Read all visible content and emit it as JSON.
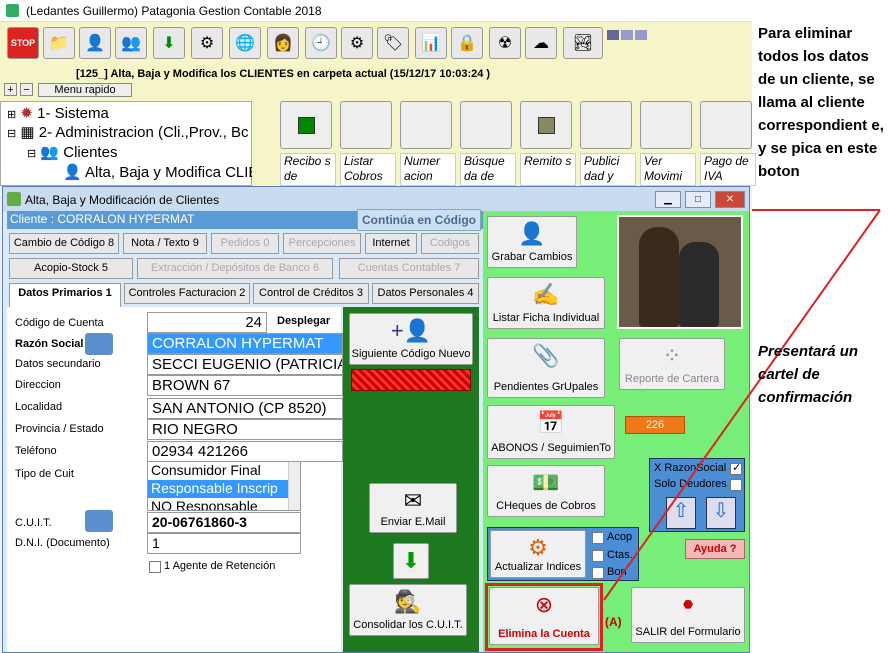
{
  "app": {
    "title": "(Ledantes Guillermo) Patagonia Gestion Contable 2018",
    "header_text": "[125_] Alta, Baja y Modifica los CLIENTES en carpeta actual (15/12/17 10:03:24 )",
    "menu_rapido": "Menu rapido",
    "plus": "+",
    "minus": "−"
  },
  "tree": {
    "items": [
      {
        "label": "1- Sistema"
      },
      {
        "label": "2- Administracion (Cli.,Prov., Bc"
      },
      {
        "label": "Clientes"
      },
      {
        "label": "Alta, Baja y Modifica CLIE"
      }
    ]
  },
  "quick": [
    {
      "label": "Recibo s de"
    },
    {
      "label": "Listar Cobros"
    },
    {
      "label": "Numer acion"
    },
    {
      "label": "Búsque da de"
    },
    {
      "label": "Remito s"
    },
    {
      "label": "Publici dad y"
    },
    {
      "label": "Ver Movimi"
    },
    {
      "label": "Pago de IVA"
    }
  ],
  "dialog": {
    "title": "Alta, Baja y Modificación de Clientes",
    "client_bar": "Cliente : CORRALON HYPERMAT",
    "continua": "Continúa en Código",
    "tabs_row1": [
      "Cambio de Código 8",
      "Nota / Texto 9",
      "Pedidos 0",
      "Percepciones",
      "Internet",
      "Codigos"
    ],
    "tabs_row2": [
      "Acopio-Stock 5",
      "Extracción / Depósitos de Banco 6",
      "Cuentas Contables 7"
    ],
    "tabs_row3": [
      "Datos Primarios 1",
      "Controles Facturacion 2",
      "Control de Créditos 3",
      "Datos Personales 4"
    ],
    "fields": {
      "codigo_label": "Código de Cuenta",
      "codigo_value": "24",
      "desplegar": "Desplegar",
      "razon_label": "Razón Social",
      "razon_value": "CORRALON HYPERMAT",
      "secundario_label": "Datos secundario",
      "secundario_value": "SECCI EUGENIO (PATRICIA",
      "direccion_label": "Direccion",
      "direccion_value": "BROWN 67",
      "localidad_label": "Localidad",
      "localidad_value": "SAN ANTONIO (CP 8520)",
      "provincia_label": "Provincia / Estado",
      "provincia_value": "RIO NEGRO",
      "telefono_label": "Teléfono",
      "telefono_value": "02934 421266",
      "cuit_tipo_label": "Tipo de Cuit",
      "cuit_options": [
        "Consumidor Final",
        "Responsable Inscrip",
        "NO Responsable"
      ],
      "cuit_label": "C.U.I.T.",
      "cuit_value": "20-06761860-3",
      "dni_label": "D.N.I. (Documento)",
      "dni_value": "1",
      "agente": "1 Agente de Retención"
    },
    "mid_buttons": {
      "siguiente": "Siguiente Código Nuevo",
      "enviar": "Enviar E.Mail",
      "consolidar": "Consolidar los C.U.I.T."
    },
    "right_buttons": {
      "grabar": "Grabar Cambios",
      "listar": "Listar Ficha Individual",
      "pendientes": "Pendientes GrUpales",
      "reporte": "Reporte de Cartera",
      "abonos": "ABONOS / SeguimienTo",
      "number": "226",
      "cheques": "CHeques de Cobros",
      "actualizar": "Actualizar Indices",
      "acop": "Acop",
      "ctas": "Ctas.",
      "bon": "Bon",
      "xrazon": "X RazonSocial",
      "solo": "Solo Deudores",
      "ayuda": "Ayuda ?",
      "elimina": "Elimina la Cuenta",
      "salir": "SALIR del Formulario",
      "a_mark": "(A)"
    }
  },
  "annotation": {
    "note1": "Para eliminar todos los datos de un cliente, se llama al cliente correspondient e, y se pica en este boton",
    "note2": "Presentará un cartel de confirmación"
  },
  "colors": {
    "highlight": "#dd2222",
    "green": "#1e7a1e",
    "lightgreen": "#77ee77"
  }
}
